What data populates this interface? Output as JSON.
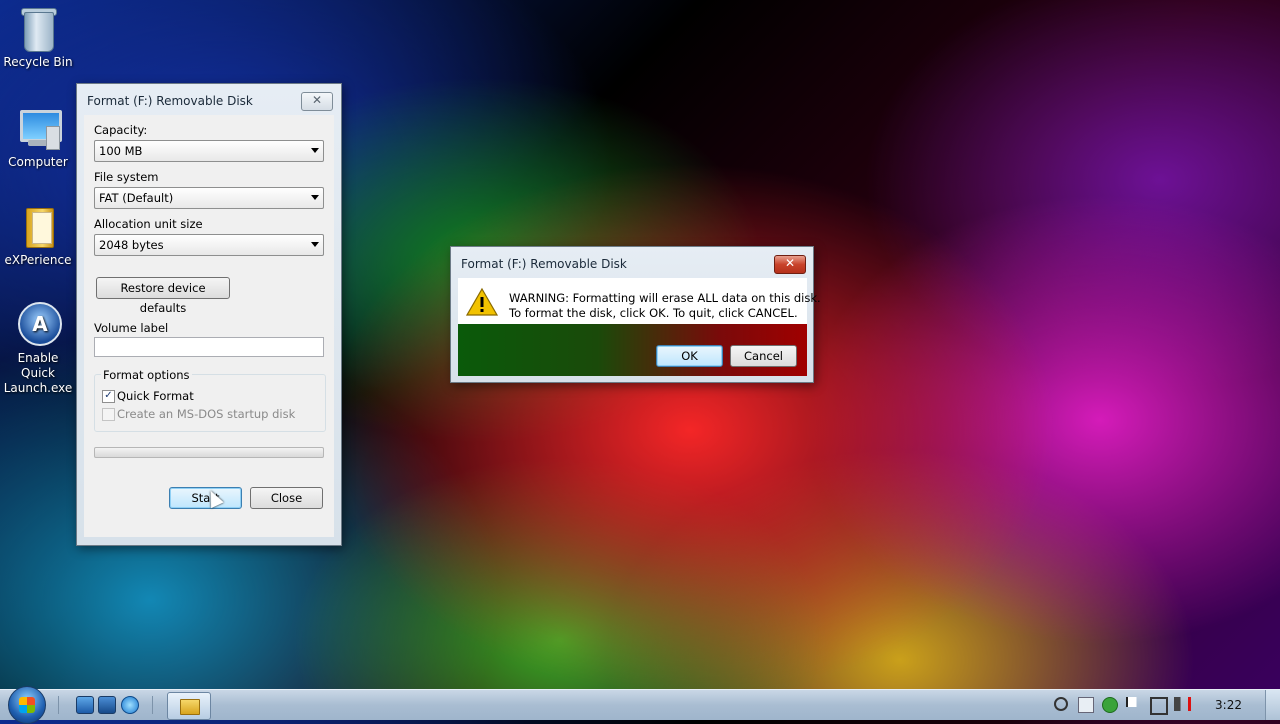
{
  "desktop": {
    "icons": [
      {
        "label": "Recycle Bin"
      },
      {
        "label": "Computer"
      },
      {
        "label": "eXPerience"
      },
      {
        "label": "Enable Quick Launch.exe"
      }
    ]
  },
  "format_window": {
    "title": "Format (F:) Removable Disk",
    "capacity_label": "Capacity:",
    "capacity_value": "100 MB",
    "filesystem_label": "File system",
    "filesystem_value": "FAT (Default)",
    "allocation_label": "Allocation unit size",
    "allocation_value": "2048 bytes",
    "restore_button": "Restore device defaults",
    "volume_label": "Volume label",
    "volume_value": "",
    "format_options_label": "Format options",
    "quick_format_label": "Quick Format",
    "quick_format_checked": true,
    "msdos_label": "Create an MS-DOS startup disk",
    "msdos_checked": false,
    "progress": 0,
    "start_button": "Start",
    "close_button": "Close"
  },
  "warning_dialog": {
    "title": "Format (F:) Removable Disk",
    "line1": "WARNING: Formatting will erase ALL data on this disk.",
    "line2": "To format the disk, click OK. To quit, click CANCEL.",
    "ok_button": "OK",
    "cancel_button": "Cancel",
    "icon": "warning-icon"
  },
  "taskbar": {
    "clock": "3:22"
  }
}
